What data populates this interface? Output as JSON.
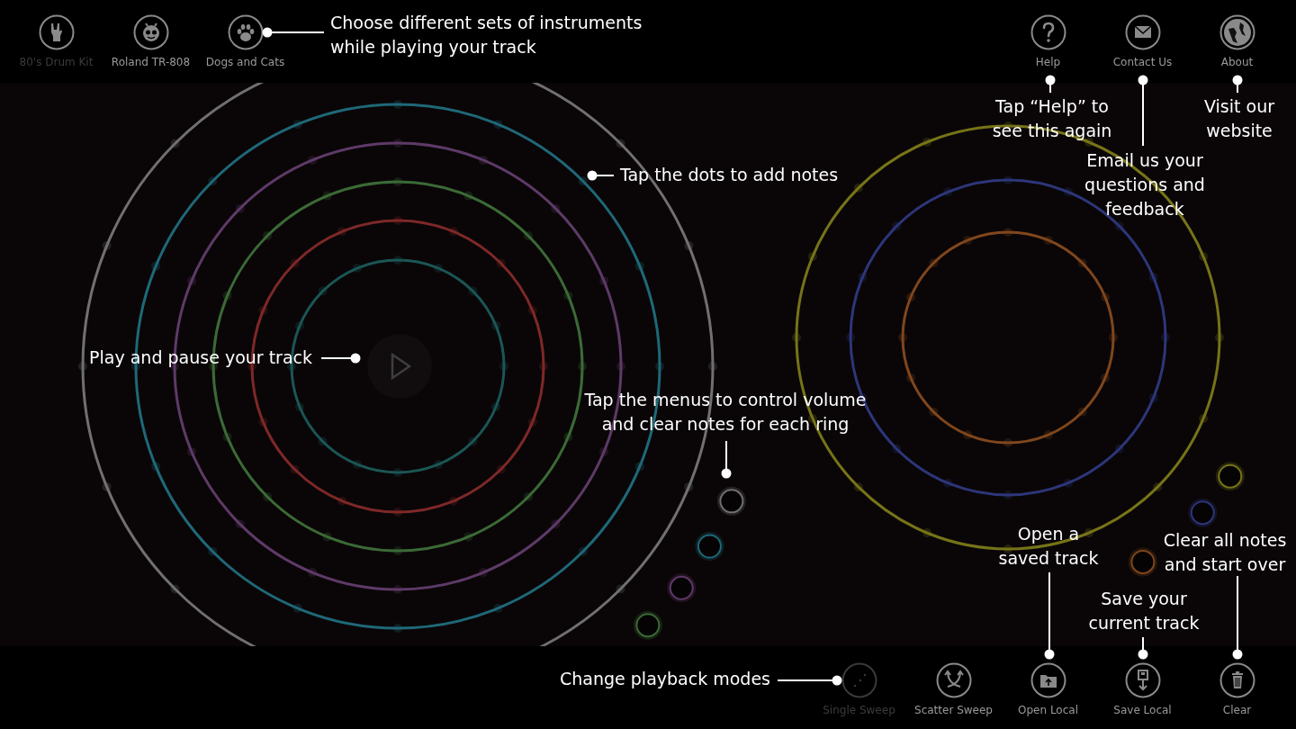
{
  "kits": [
    {
      "label": "80's Drum Kit",
      "disabled": true
    },
    {
      "label": "Roland TR-808",
      "disabled": false
    },
    {
      "label": "Dogs and Cats",
      "disabled": false
    }
  ],
  "top_actions": [
    {
      "label": "Help"
    },
    {
      "label": "Contact Us"
    },
    {
      "label": "About"
    }
  ],
  "sequencers": [
    {
      "rings": [
        {
          "color": "#707070"
        },
        {
          "color": "#1f6878"
        },
        {
          "color": "#5e3a68"
        },
        {
          "color": "#3b6a36"
        },
        {
          "color": "#7e2828"
        },
        {
          "color": "#1b5656"
        }
      ]
    },
    {
      "rings": [
        {
          "color": "#767418"
        },
        {
          "color": "#2d367a"
        },
        {
          "color": "#80461c"
        }
      ]
    }
  ],
  "bottom_actions": [
    {
      "label": "Single Sweep",
      "disabled": true
    },
    {
      "label": "Scatter Sweep",
      "disabled": false
    },
    {
      "label": "Open Local",
      "disabled": false
    },
    {
      "label": "Save Local",
      "disabled": false
    },
    {
      "label": "Clear",
      "disabled": false
    }
  ],
  "callouts": [
    {
      "lines": [
        "Choose different sets of instruments",
        "while playing your track"
      ]
    },
    {
      "lines": [
        "Tap “Help” to",
        "see this again"
      ]
    },
    {
      "lines": [
        "Email us your",
        "questions and",
        "feedback"
      ]
    },
    {
      "lines": [
        "Visit our",
        "website"
      ]
    },
    {
      "lines": [
        "Tap the dots to add notes"
      ]
    },
    {
      "lines": [
        "Play and pause your track"
      ]
    },
    {
      "lines": [
        "Tap the menus to control volume",
        "and clear notes for each ring"
      ]
    },
    {
      "lines": [
        "Open a",
        "saved track"
      ]
    },
    {
      "lines": [
        "Save your",
        "current track"
      ]
    },
    {
      "lines": [
        "Clear all notes",
        "and start over"
      ]
    },
    {
      "lines": [
        "Change playback modes"
      ]
    }
  ]
}
